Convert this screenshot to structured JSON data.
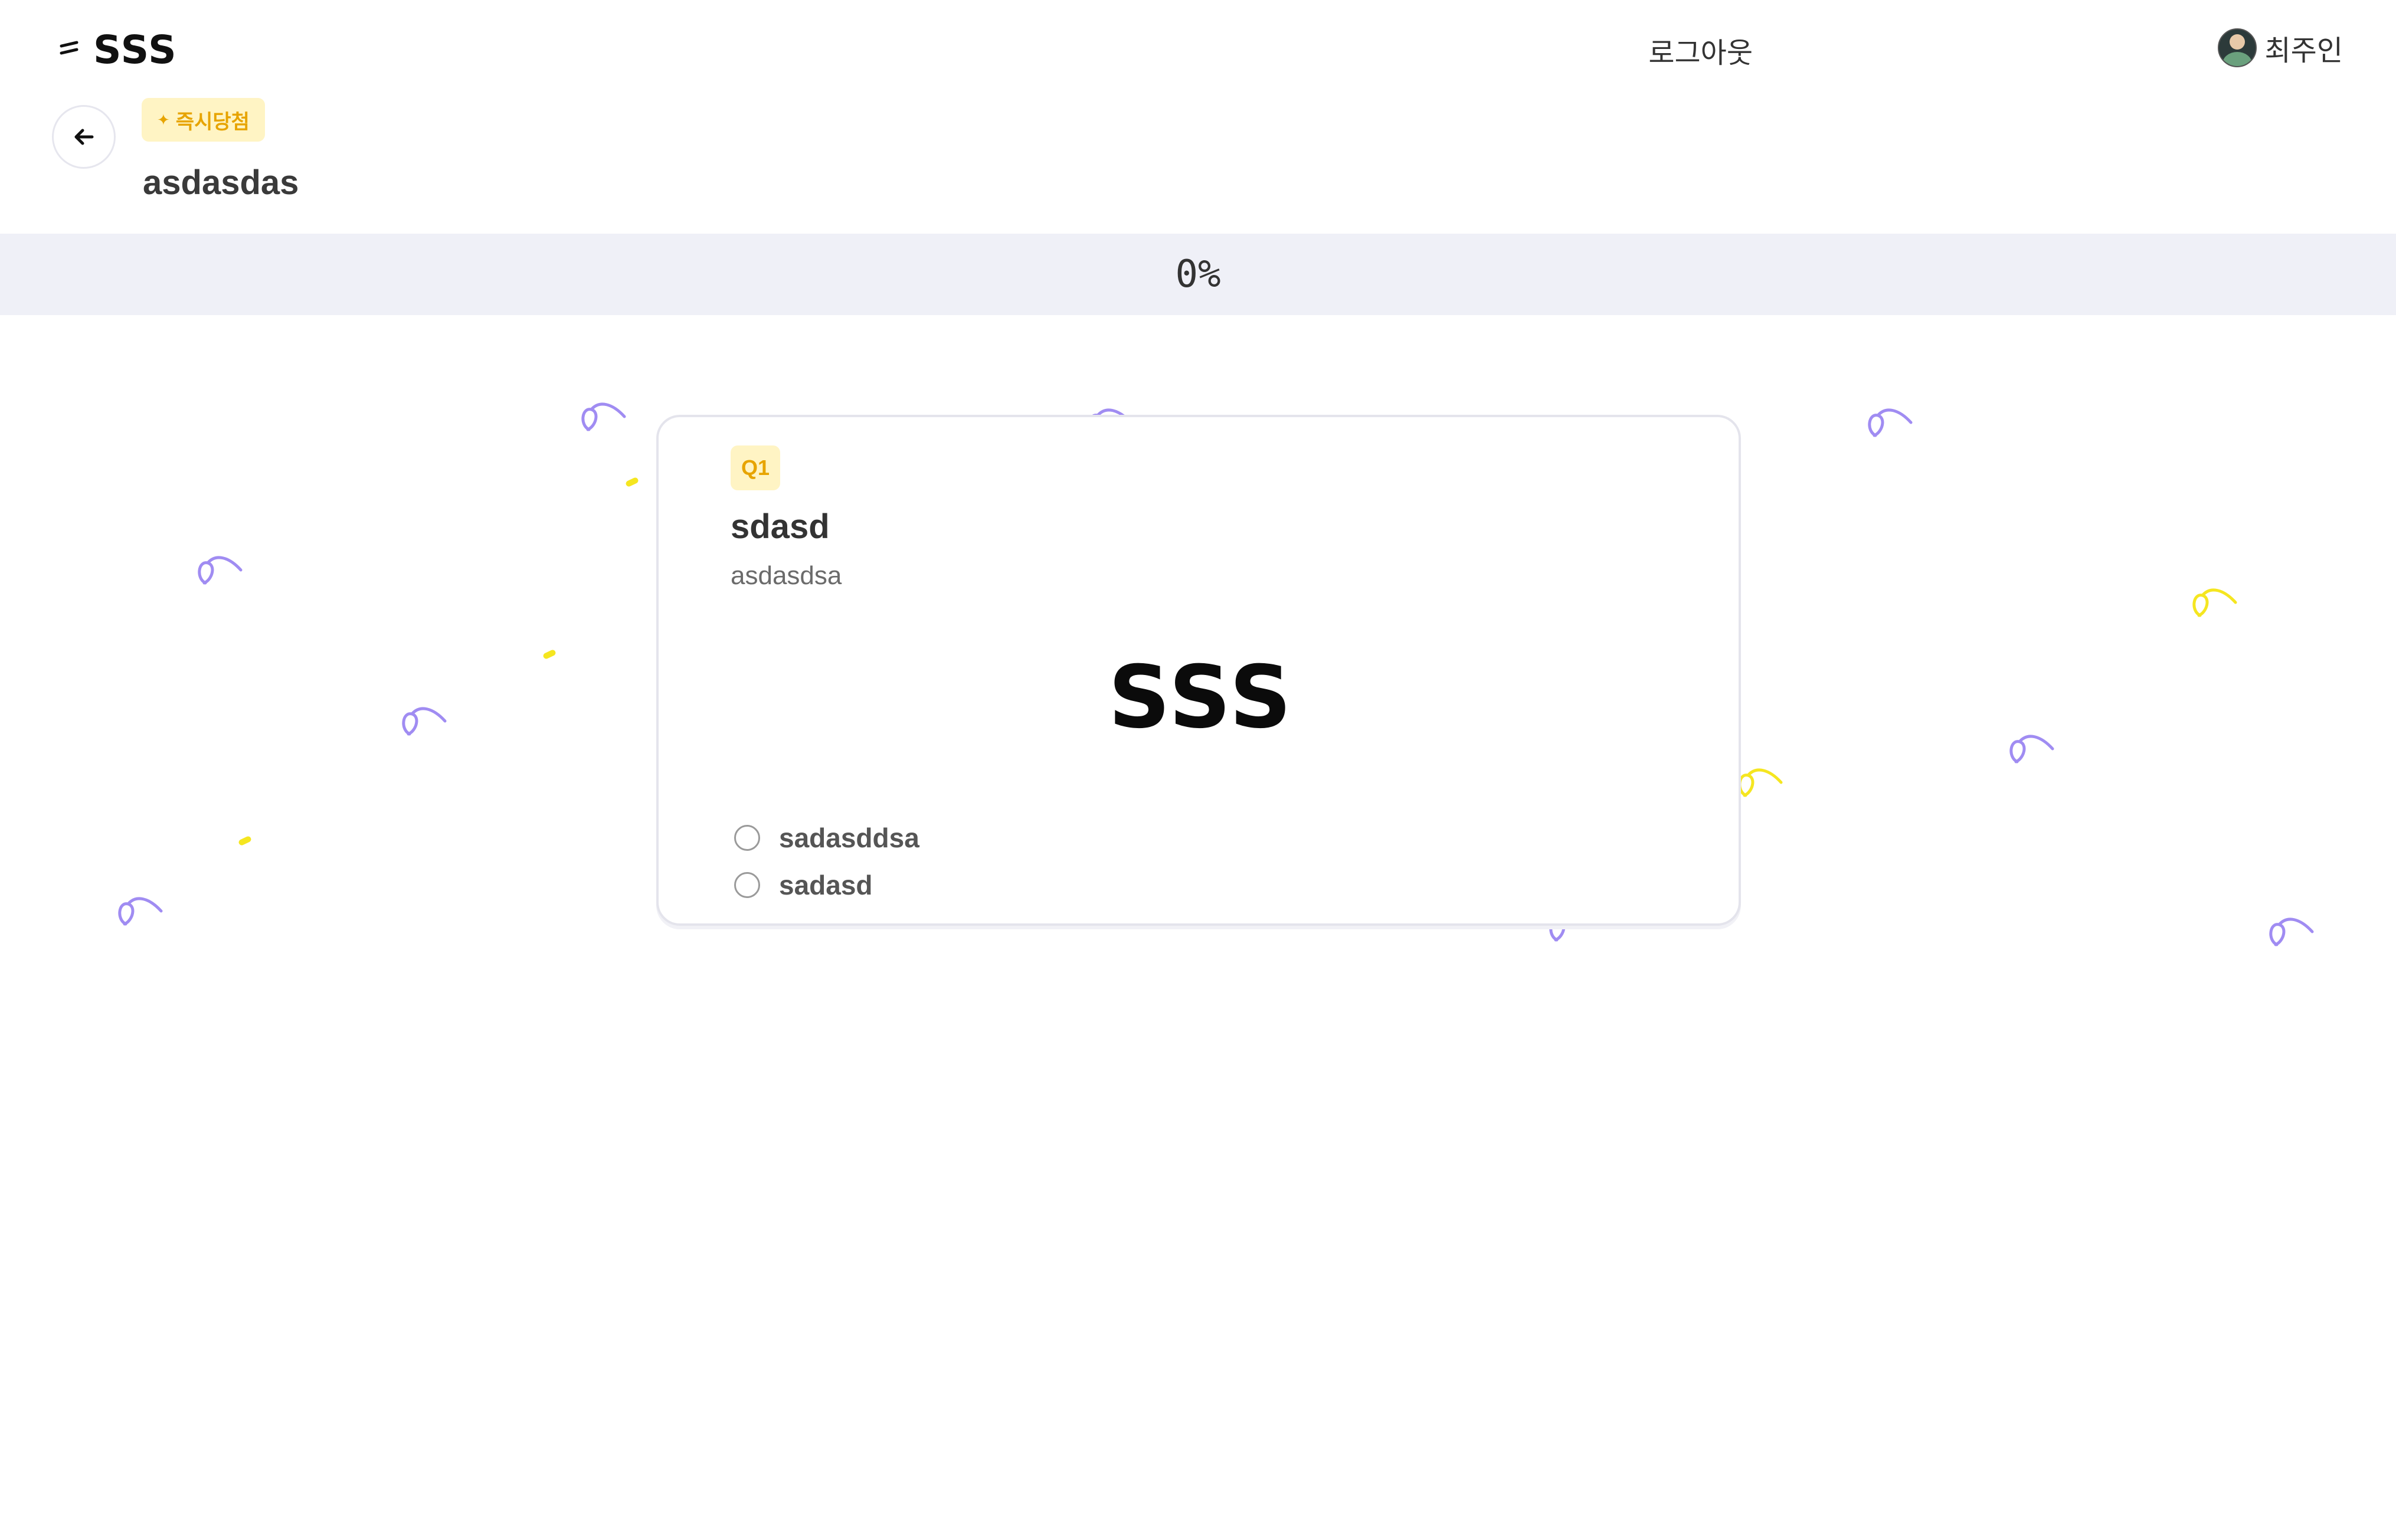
{
  "header": {
    "brand": "SSS",
    "logout_label": "로그아웃",
    "user_name": "최주인"
  },
  "survey": {
    "badge": "즉시당첨",
    "title": "asdasdas"
  },
  "progress": {
    "percent_label": "0%",
    "value": 0
  },
  "question": {
    "badge": "Q1",
    "title": "sdasd",
    "description": "asdasdsa",
    "image_text": "SSS",
    "options": [
      {
        "label": "sadasddsa",
        "selected": false
      },
      {
        "label": "sadasd",
        "selected": false
      }
    ]
  },
  "colors": {
    "accent_yellow_bg": "#fff4c4",
    "accent_yellow_text": "#e7a400",
    "progress_bg": "#eff0f7",
    "confetti_purple": "#a08cf2",
    "confetti_yellow": "#f5e620"
  }
}
